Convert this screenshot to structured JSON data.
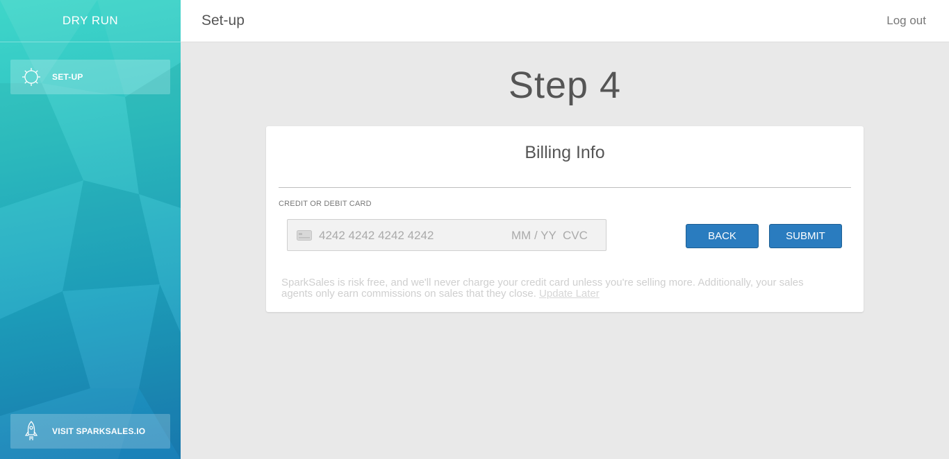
{
  "sidebar": {
    "brand": "DRY RUN",
    "items": [
      {
        "label": "SET-UP",
        "icon": "gear-icon"
      },
      {
        "label": "VISIT SPARKSALES.IO",
        "icon": "rocket-icon"
      }
    ]
  },
  "header": {
    "title": "Set-up",
    "logout_label": "Log out"
  },
  "main": {
    "step_title": "Step 4",
    "card": {
      "title": "Billing Info",
      "field_label": "CREDIT OR DEBIT CARD",
      "card_number_placeholder": "4242 4242 4242 4242",
      "expiry_placeholder": "MM / YY",
      "cvc_placeholder": "CVC",
      "back_label": "BACK",
      "submit_label": "SUBMIT",
      "note_text": "SparkSales is risk free, and we'll never charge your credit card unless you're selling more. Additionally, your sales agents only earn commissions on sales that they close.",
      "note_link": "Update Later"
    }
  },
  "colors": {
    "sidebar_top": "#3fd6c9",
    "sidebar_bottom": "#1a7fb8",
    "button_primary": "#2a7cbf",
    "page_background": "#e9e9e9"
  }
}
